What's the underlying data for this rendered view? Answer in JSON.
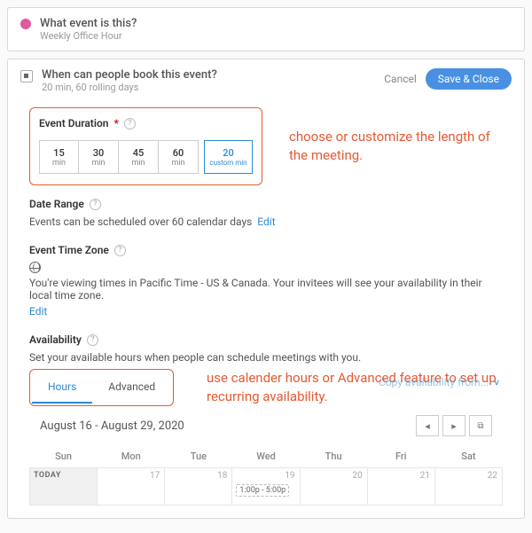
{
  "header1": {
    "title": "What event is this?",
    "subtitle": "Weekly Office Hour"
  },
  "header2": {
    "title": "When can people book this event?",
    "subtitle": "20 min, 60 rolling days",
    "cancel": "Cancel",
    "save": "Save & Close"
  },
  "duration": {
    "label": "Event Duration",
    "required": "*",
    "options": [
      {
        "n": "15",
        "u": "min"
      },
      {
        "n": "30",
        "u": "min"
      },
      {
        "n": "45",
        "u": "min"
      },
      {
        "n": "60",
        "u": "min"
      }
    ],
    "custom": {
      "n": "20",
      "u": "custom min"
    },
    "annotation": "choose or customize the length of the meeting."
  },
  "dateRange": {
    "label": "Date Range",
    "text": "Events can be scheduled over 60 calendar days",
    "edit": "Edit"
  },
  "timezone": {
    "label": "Event Time Zone",
    "text": "You're viewing times in Pacific Time - US & Canada. Your invitees will see your availability in their local time zone.",
    "edit": "Edit"
  },
  "availability": {
    "label": "Availability",
    "text": "Set your available hours when people can schedule meetings with you.",
    "tabs": {
      "hours": "Hours",
      "advanced": "Advanced"
    },
    "copy": "Copy availability from...",
    "annotation": "use calender hours or Advanced feature to set up recurring availability."
  },
  "calendar": {
    "range": "August 16 - August 29, 2020",
    "days": [
      "Sun",
      "Mon",
      "Tue",
      "Wed",
      "Thu",
      "Fri",
      "Sat"
    ],
    "today": "TODAY",
    "nums": [
      "",
      "17",
      "18",
      "19",
      "20",
      "21",
      "22"
    ],
    "slot": "1:00p - 5:00p"
  }
}
